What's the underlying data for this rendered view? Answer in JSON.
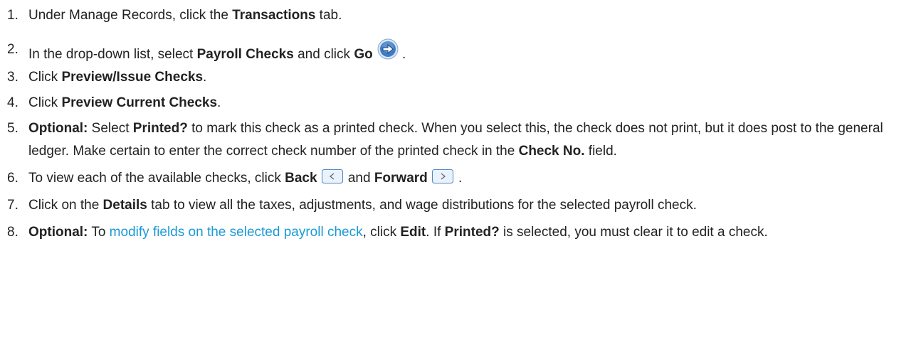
{
  "steps": [
    {
      "num": "1.",
      "parts": [
        "Under Manage Records, click the ",
        "Transactions",
        " tab."
      ]
    },
    {
      "num": "2.",
      "parts": [
        "In the drop-down list, select ",
        "Payroll Checks",
        " and click ",
        "Go",
        " ."
      ],
      "icon": "go-arrow-icon"
    },
    {
      "num": "3.",
      "parts": [
        "Click ",
        "Preview/Issue Checks",
        "."
      ]
    },
    {
      "num": "4.",
      "parts": [
        "Click ",
        "Preview Current Checks",
        "."
      ]
    },
    {
      "num": "5.",
      "parts": [
        "Optional:",
        " Select ",
        "Printed?",
        " to mark this check as a printed check. When you select this, the check does not print, but it does post to the general ledger. Make certain to enter the correct check number of the printed check in the ",
        "Check No.",
        " field."
      ]
    },
    {
      "num": "6.",
      "parts": [
        "To view each of the available checks, click ",
        "Back",
        " and ",
        "Forward",
        " ."
      ],
      "icons": [
        "back-button-icon",
        "forward-button-icon"
      ]
    },
    {
      "num": "7.",
      "parts": [
        "Click on the ",
        "Details",
        " tab to view all the taxes, adjustments, and wage distributions for the selected payroll check."
      ]
    },
    {
      "num": "8.",
      "parts": [
        "Optional:",
        " To ",
        "modify fields on the selected payroll check",
        ", click ",
        "Edit",
        ". If ",
        "Printed?",
        " is selected, you must clear it to edit a check."
      ]
    }
  ],
  "colors": {
    "text": "#222222",
    "link": "#1a9ad6",
    "icon_blue": "#2f6fb3"
  }
}
